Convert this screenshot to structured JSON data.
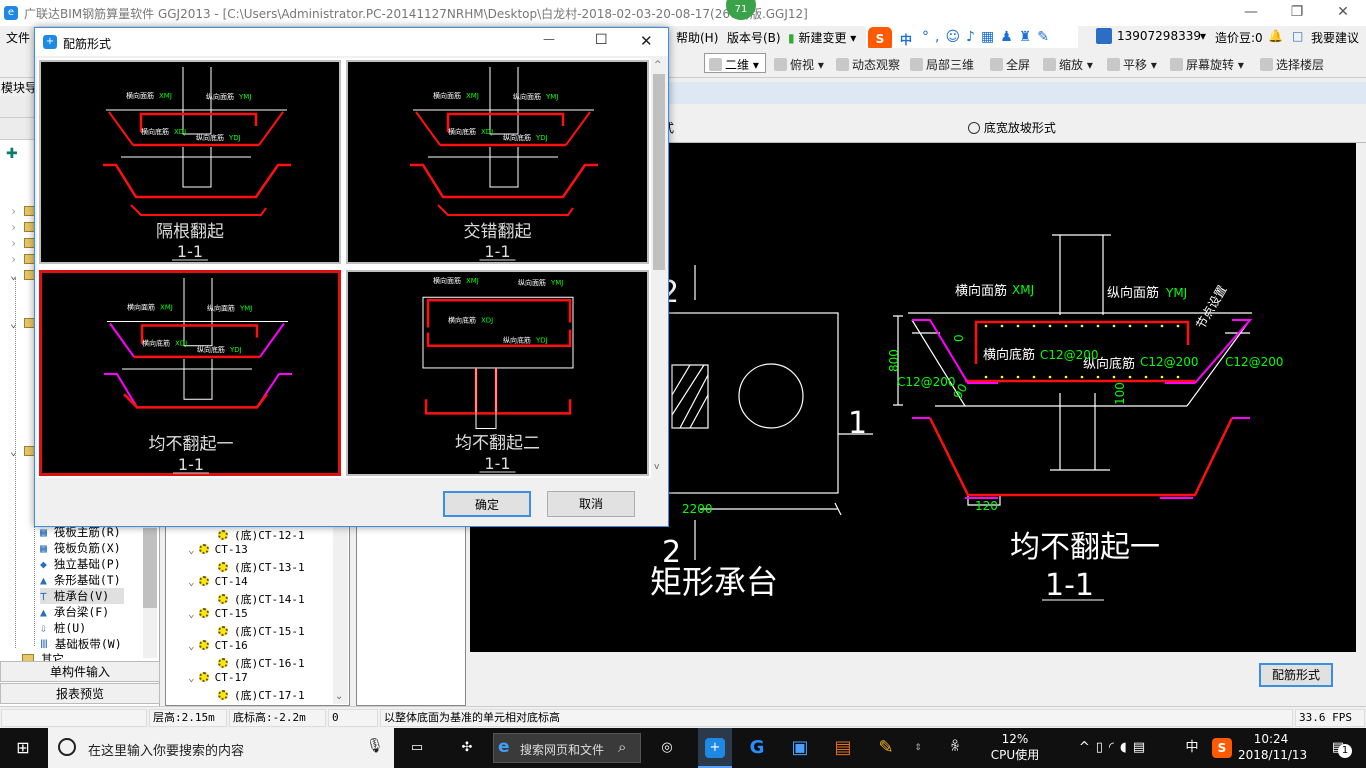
{
  "window": {
    "title": "广联达BIM钢筋算量软件 GGJ2013 - [C:\\Users\\Administrator.PC-20141127NRHM\\Desktop\\白龙村-2018-02-03-20-08-17(2660)版.GGJ12]",
    "badge": "71"
  },
  "menu": {
    "file": "文件",
    "help": "帮助(H)",
    "version": "版本号(B)",
    "new_change": "新建变更",
    "phone": "13907298339",
    "beans": "造价豆:0",
    "suggest": "我要建议",
    "ime": "中"
  },
  "toolbar": {
    "view2d": "二维",
    "top_view": "俯视",
    "dynamic": "动态观察",
    "local3d": "局部三维",
    "fullscreen": "全屏",
    "zoom": "缩放",
    "pan": "平移",
    "rotate": "屏幕旋转",
    "floor": "选择楼层"
  },
  "left_panel": {
    "header": "模块导航栏",
    "items": [
      "筏板主筋(R)",
      "筏板负筋(X)",
      "独立基础(P)",
      "条形基础(T)",
      "桩承台(V)",
      "承台梁(F)",
      "桩(U)",
      "基础板带(W)"
    ],
    "selected": "桩承台(V)",
    "other": "其它",
    "btn_single": "单构件输入",
    "btn_report": "报表预览"
  },
  "mid_list": [
    "(底)CT-12-1",
    "CT-13",
    "(底)CT-13-1",
    "CT-14",
    "(底)CT-14-1",
    "CT-15",
    "(底)CT-15-1",
    "CT-16",
    "(底)CT-16-1",
    "CT-17",
    "(底)CT-17-1"
  ],
  "main": {
    "radio_left": "形式",
    "radio_right": "底宽放坡形式",
    "button": "配筋形式",
    "drawing": {
      "plan_title": "矩形承台",
      "sec_mark_2": "2",
      "sec_mark_1": "1",
      "dim_width": "2200",
      "section_title": "均不翻起一",
      "section_sub": "1-1",
      "xmj": "横向面筋",
      "xmj_code": "XMJ",
      "ymj": "纵向面筋",
      "ymj_code": "YMJ",
      "xdj": "横向底筋",
      "ydj": "纵向底筋",
      "rebar": "C12@200",
      "h": "800",
      "angle": "90",
      "d100": "100",
      "d120": "120",
      "slope": "节点设置",
      "zero": "0"
    }
  },
  "dialog": {
    "title": "配筋形式",
    "ok": "确定",
    "cancel": "取消",
    "options": [
      {
        "name": "隔根翻起",
        "sub": "1-1",
        "selected": false
      },
      {
        "name": "交错翻起",
        "sub": "1-1",
        "selected": false
      },
      {
        "name": "均不翻起一",
        "sub": "1-1",
        "selected": true
      },
      {
        "name": "均不翻起二",
        "sub": "1-1",
        "selected": false
      }
    ],
    "labels": {
      "xmj": "横向面筋",
      "xmj_code": "XMJ",
      "ymj": "纵向面筋",
      "ymj_code": "YMJ",
      "xdj": "横向底筋",
      "xdj_code": "XDJ",
      "ydj": "纵向底筋",
      "ydj_code": "YDJ"
    }
  },
  "status": {
    "c1": "",
    "floor_h": "层高:2.15m",
    "bottom_el": "底标高:-2.2m",
    "zero": "0",
    "hint": "以整体底面为基准的单元相对底标高",
    "fps": "33.6 FPS"
  },
  "taskbar": {
    "search": "在这里输入你要搜索的内容",
    "web_search": "搜索网页和文件",
    "cpu": "12%",
    "cpu_label": "CPU使用",
    "ime": "中",
    "time": "10:24",
    "date": "2018/11/13",
    "notif": "1"
  },
  "colors": {
    "accent": "#3c8ee0",
    "rebar_red": "#ff1010",
    "magenta": "#ff00ff",
    "dim_green": "#00ff00"
  }
}
